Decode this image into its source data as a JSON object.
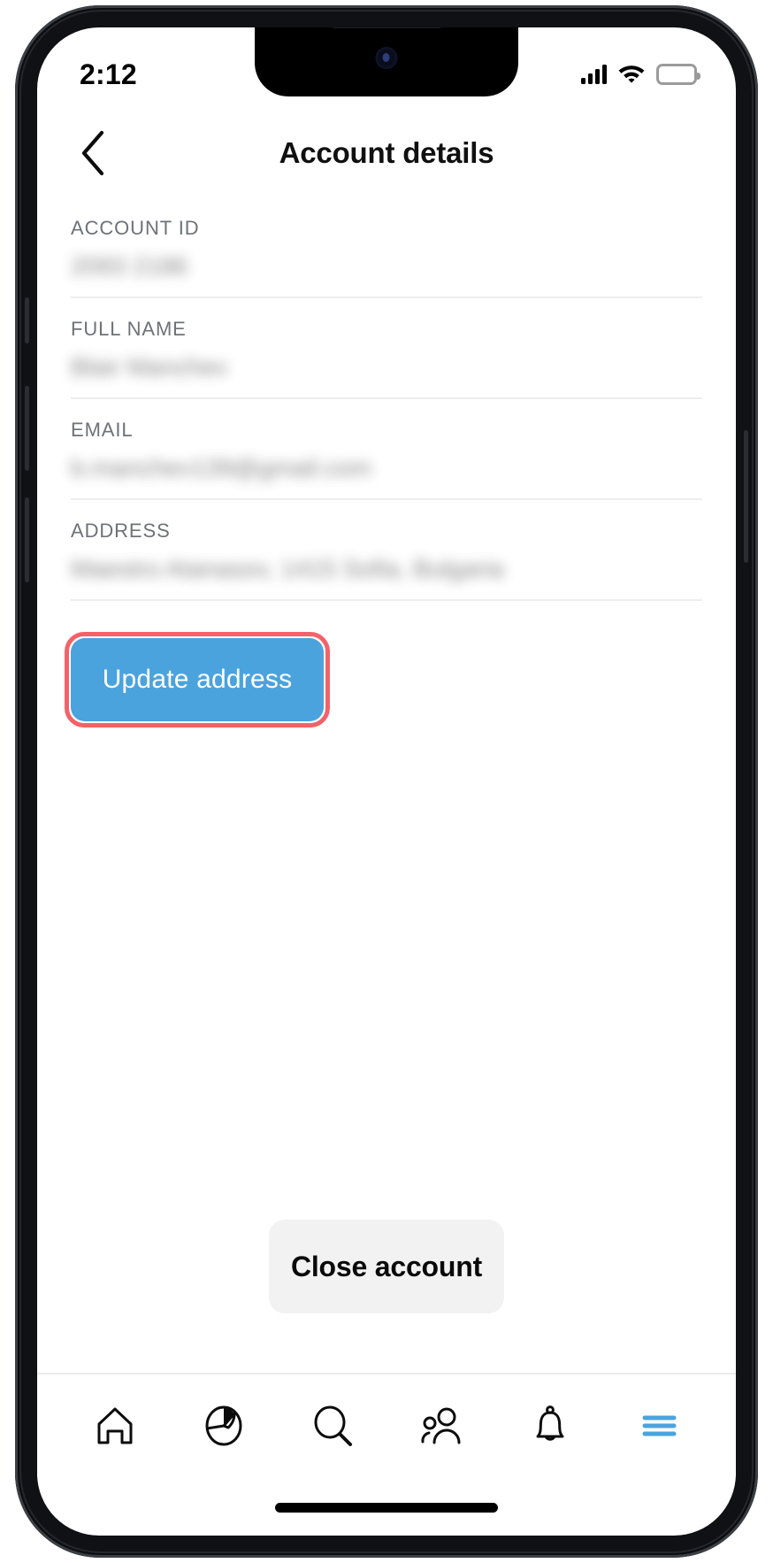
{
  "status_bar": {
    "time": "2:12",
    "cellular_icon": "cellular-signal-icon",
    "wifi_icon": "wifi-icon",
    "battery_icon": "battery-full-icon"
  },
  "header": {
    "back_icon": "chevron-left-icon",
    "title": "Account details"
  },
  "fields": [
    {
      "label": "ACCOUNT ID",
      "value": "2093 2186",
      "redacted": true
    },
    {
      "label": "FULL NAME",
      "value": "Blair Manchev",
      "redacted": true
    },
    {
      "label": "EMAIL",
      "value": "b.manchev139@gmail.com",
      "redacted": true
    },
    {
      "label": "ADDRESS",
      "value": "Maestro Atanasov, 1415 Sofia, Bulgaria",
      "redacted": true
    }
  ],
  "actions": {
    "update_address_label": "Update address",
    "close_account_label": "Close account"
  },
  "colors": {
    "primary_blue": "#4ba3dd",
    "highlight_red": "#f4616a",
    "close_button_bg": "#f2f2f3",
    "label_gray": "#6e7278",
    "divider": "#ededed"
  },
  "bottom_nav": [
    {
      "icon": "home-icon",
      "active": false
    },
    {
      "icon": "pie-chart-icon",
      "active": false
    },
    {
      "icon": "search-icon",
      "active": false
    },
    {
      "icon": "people-icon",
      "active": false
    },
    {
      "icon": "bell-icon",
      "active": false
    },
    {
      "icon": "hamburger-menu-icon",
      "active": true
    }
  ]
}
